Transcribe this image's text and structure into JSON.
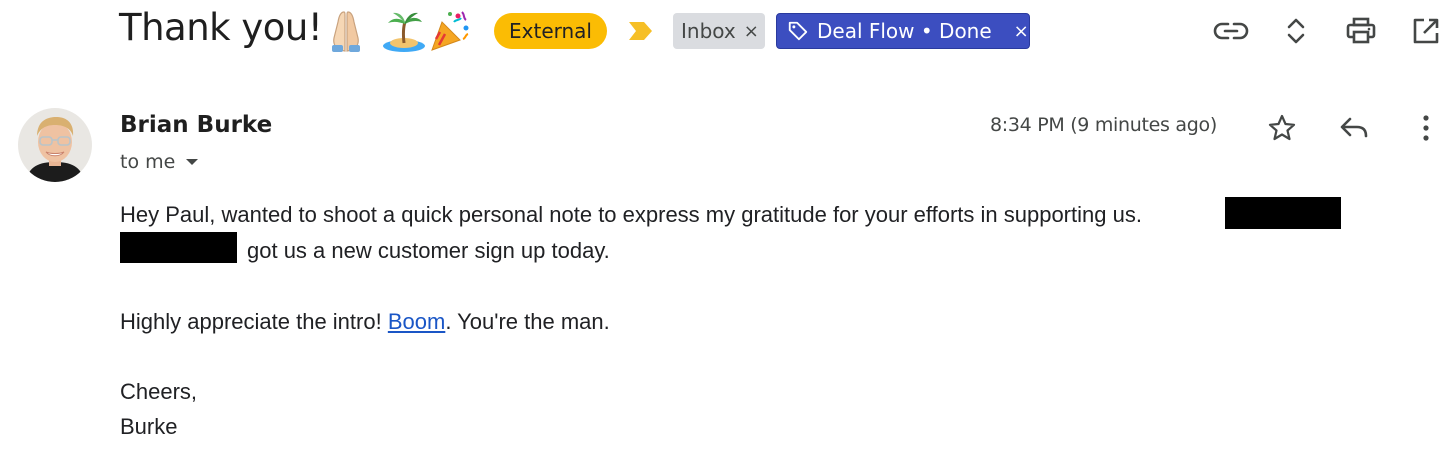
{
  "subject": {
    "title": "Thank you!",
    "emojis": [
      "folded-hands-emoji",
      "desert-island-emoji",
      "party-popper-emoji"
    ]
  },
  "labels": {
    "external": "External",
    "inbox": "Inbox",
    "deal_flow": "Deal Flow • Done",
    "remove_symbol": "×"
  },
  "toolbar": {
    "icons": [
      "link-icon",
      "expand-collapse-icon",
      "print-icon",
      "open-in-new-window-icon"
    ]
  },
  "message": {
    "sender": "Brian Burke",
    "recipient": "to me",
    "timestamp": "8:34 PM (9 minutes ago)",
    "actions": [
      "star-icon",
      "reply-icon",
      "more-options-icon"
    ],
    "body": {
      "line1": "Hey Paul, wanted to shoot a quick personal note to express my gratitude for your efforts in supporting us.",
      "line2": "got us a new customer sign up today.",
      "line3_before": "Highly appreciate the intro! ",
      "line3_link": "Boom",
      "line3_after": ". You're the man.",
      "closing": "Cheers,",
      "signature": "Burke"
    }
  },
  "colors": {
    "external_chip": "#fbbc04",
    "inbox_chip": "#dadce0",
    "deal_chip": "#3c4ec0",
    "link": "#1a56c6",
    "importance_marker": "#f6bf26"
  }
}
